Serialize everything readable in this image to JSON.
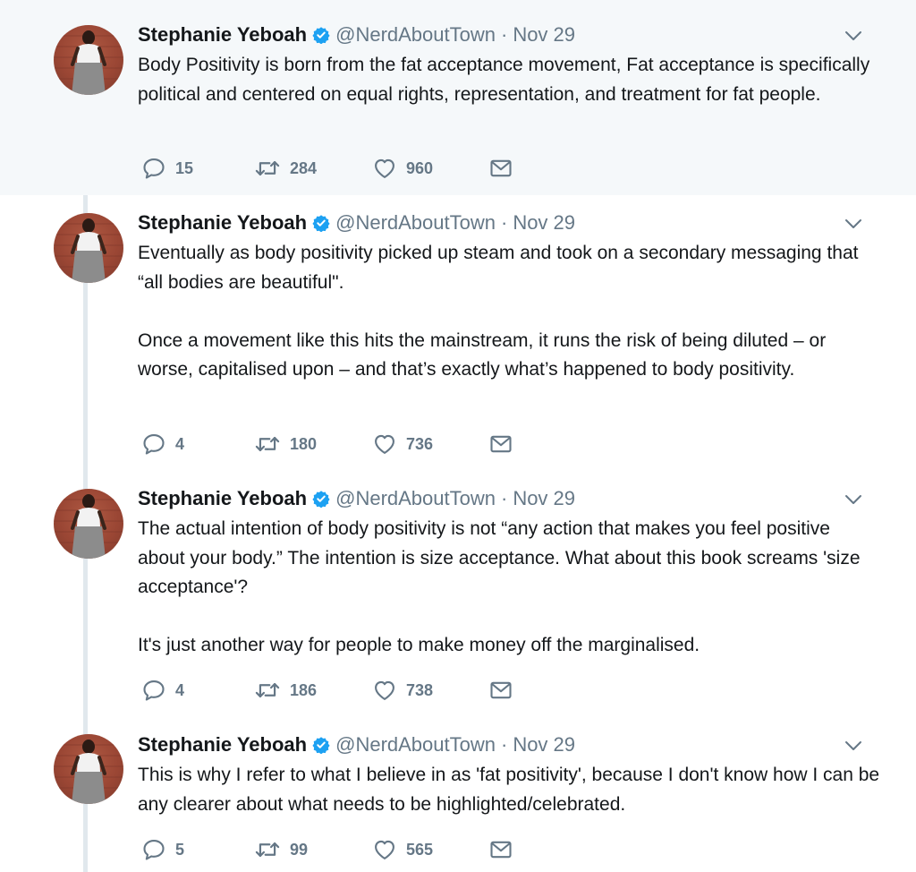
{
  "tweets": [
    {
      "author": "Stephanie Yeboah",
      "handle": "@NerdAboutTown",
      "separator": "·",
      "date": "Nov 29",
      "paragraphs": [
        "Body Positivity is born from the fat acceptance movement, Fat acceptance is specifically political and centered on equal rights, representation, and treatment for fat people."
      ],
      "replies": "15",
      "retweets": "284",
      "likes": "960"
    },
    {
      "author": "Stephanie Yeboah",
      "handle": "@NerdAboutTown",
      "separator": "·",
      "date": "Nov 29",
      "paragraphs": [
        "Eventually as body positivity picked up steam and took on a secondary messaging that “all bodies are beautiful\".",
        "Once a movement like this hits the mainstream, it runs the risk of being diluted – or worse, capitalised upon – and that’s exactly what’s happened to body positivity."
      ],
      "replies": "4",
      "retweets": "180",
      "likes": "736"
    },
    {
      "author": "Stephanie Yeboah",
      "handle": "@NerdAboutTown",
      "separator": "·",
      "date": "Nov 29",
      "paragraphs": [
        "The actual intention of body positivity is not “any action that makes you feel positive about your body.” The intention is size acceptance. What about this book screams 'size acceptance'?",
        "It's just another way for people to make money off the marginalised."
      ],
      "replies": "4",
      "retweets": "186",
      "likes": "738"
    },
    {
      "author": "Stephanie Yeboah",
      "handle": "@NerdAboutTown",
      "separator": "·",
      "date": "Nov 29",
      "paragraphs": [
        "This is why I refer to what I believe in as 'fat positivity', because I don't know how I can be any clearer about what needs to be highlighted/celebrated."
      ],
      "replies": "5",
      "retweets": "99",
      "likes": "565"
    }
  ],
  "icons": {
    "verified": "verified-badge-icon",
    "caret": "chevron-down-icon",
    "reply": "reply-icon",
    "retweet": "retweet-icon",
    "like": "heart-icon",
    "dm": "envelope-icon"
  },
  "colors": {
    "highlight_background": "#f5f8fa",
    "thread_line": "#e1e8ed",
    "verified_blue": "#1da1f2",
    "secondary_text": "#657786",
    "primary_text": "#14171a"
  }
}
